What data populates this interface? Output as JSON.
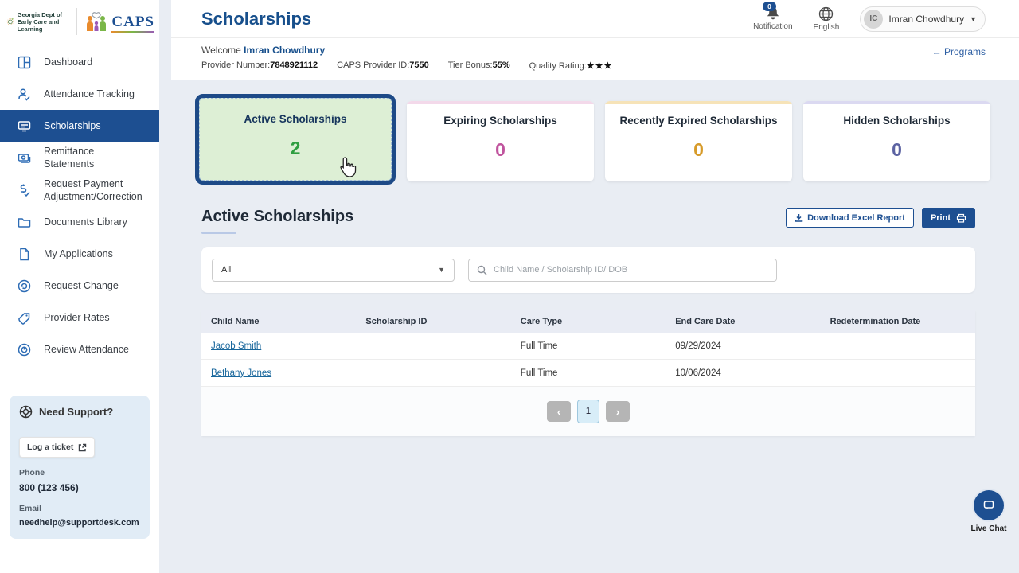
{
  "branding": {
    "org_name": "Georgia Dept of Early Care and Learning",
    "app_name": "CAPS"
  },
  "sidebar": {
    "items": [
      {
        "label": "Dashboard",
        "icon": "dashboard-icon"
      },
      {
        "label": "Attendance Tracking",
        "icon": "attendance-icon"
      },
      {
        "label": "Scholarships",
        "icon": "scholarships-icon",
        "active": true
      },
      {
        "label": "Remittance Statements",
        "icon": "remittance-icon"
      },
      {
        "label": "Request Payment Adjustment/Correction",
        "icon": "payment-adjustment-icon"
      },
      {
        "label": "Documents Library",
        "icon": "folder-icon"
      },
      {
        "label": "My Applications",
        "icon": "document-icon"
      },
      {
        "label": "Request Change",
        "icon": "refresh-icon"
      },
      {
        "label": "Provider Rates",
        "icon": "tag-icon"
      },
      {
        "label": "Review Attendance",
        "icon": "clock-icon"
      }
    ],
    "support": {
      "title": "Need Support?",
      "ticket_button": "Log a ticket",
      "phone_label": "Phone",
      "phone": "800 (123 456)",
      "email_label": "Email",
      "email": "needhelp@supportdesk.com"
    }
  },
  "header": {
    "title": "Scholarships",
    "notification_label": "Notification",
    "notification_count": "0",
    "language_label": "English",
    "user": {
      "initials": "IC",
      "name": "Imran Chowdhury",
      "caret": "▼"
    }
  },
  "welcome": {
    "greeting": "Welcome",
    "user_name": "Imran Chowdhury",
    "provider_number_label": "Provider Number:",
    "provider_number": "7848921112",
    "caps_id_label": "CAPS Provider ID:",
    "caps_id": "7550",
    "tier_label": "Tier Bonus:",
    "tier": "55%",
    "rating_label": "Quality Rating:",
    "rating_stars": "★★★",
    "back_arrow": "←",
    "programs_link": "Programs"
  },
  "cards": [
    {
      "title": "Active Scholarships",
      "value": "2",
      "accent": "#2f9e41",
      "band": "#ddefd5",
      "selected": true
    },
    {
      "title": "Expiring Scholarships",
      "value": "0",
      "accent": "#c0549e",
      "band": "#f3d9ea"
    },
    {
      "title": "Recently Expired Scholarships",
      "value": "0",
      "accent": "#d79b2a",
      "band": "#f6e3b8"
    },
    {
      "title": "Hidden Scholarships",
      "value": "0",
      "accent": "#5c63a2",
      "band": "#dbd9f1"
    }
  ],
  "section": {
    "title": "Active Scholarships",
    "download_button": "Download Excel Report",
    "print_button": "Print"
  },
  "filters": {
    "dropdown_value": "All",
    "dropdown_caret": "▼",
    "search_placeholder": "Child Name / Scholarship ID/ DOB"
  },
  "table": {
    "columns": [
      "Child Name",
      "Scholarship ID",
      "Care Type",
      "End Care Date",
      "Redetermination Date"
    ],
    "rows": [
      {
        "child_name": "Jacob Smith",
        "scholarship_id": "",
        "care_type": "Full Time",
        "end_care_date": "09/29/2024",
        "redetermination_date": ""
      },
      {
        "child_name": "Bethany Jones",
        "scholarship_id": "",
        "care_type": "Full Time",
        "end_care_date": "10/06/2024",
        "redetermination_date": ""
      }
    ],
    "pagination": {
      "prev_icon": "‹",
      "current_page": "1",
      "next_icon": "›"
    }
  },
  "chat": {
    "label": "Live Chat"
  },
  "colors": {
    "primary": "#1d4f91",
    "selected_card_border": "#1d4a87",
    "link": "#19679c",
    "content_bg": "#e9edf3"
  }
}
